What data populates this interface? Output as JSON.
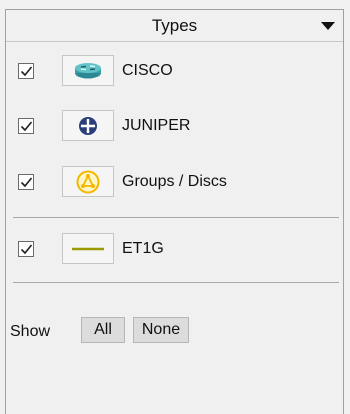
{
  "panel": {
    "title": "Types",
    "types": [
      {
        "label": "CISCO",
        "checked": true,
        "icon": "router-icon"
      },
      {
        "label": "JUNIPER",
        "checked": true,
        "icon": "juniper-icon"
      },
      {
        "label": "Groups / Discs",
        "checked": true,
        "icon": "group-icon"
      }
    ],
    "links": [
      {
        "label": "ET1G",
        "checked": true,
        "icon": "link-line-icon"
      }
    ],
    "show": {
      "label": "Show",
      "all_label": "All",
      "none_label": "None"
    }
  },
  "colors": {
    "cisco": "#3a9fa6",
    "juniper": "#2a3f7a",
    "group": "#f2b800",
    "link_line": "#9a9a00"
  }
}
